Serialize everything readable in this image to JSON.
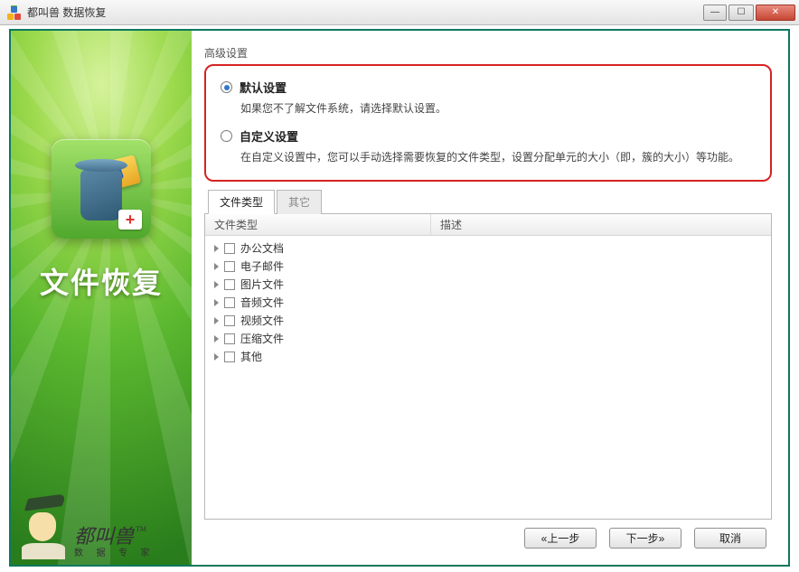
{
  "window": {
    "title": "都叫兽 数据恢复"
  },
  "sidebar": {
    "title": "文件恢复",
    "brand_name": "都叫兽",
    "brand_tagline": "数 据 专 家",
    "tm": "TM"
  },
  "settings": {
    "group_label": "高级设置",
    "default": {
      "label": "默认设置",
      "desc": "如果您不了解文件系统，请选择默认设置。"
    },
    "custom": {
      "label": "自定义设置",
      "desc": "在自定义设置中，您可以手动选择需要恢复的文件类型，设置分配单元的大小（即，簇的大小）等功能。"
    }
  },
  "tabs": {
    "file_type": "文件类型",
    "other": "其它"
  },
  "table": {
    "col_type": "文件类型",
    "col_desc": "描述",
    "rows": [
      {
        "label": "办公文档"
      },
      {
        "label": "电子邮件"
      },
      {
        "label": "图片文件"
      },
      {
        "label": "音频文件"
      },
      {
        "label": "视频文件"
      },
      {
        "label": "压缩文件"
      },
      {
        "label": "其他"
      }
    ]
  },
  "footer": {
    "prev": "«上一步",
    "next": "下一步»",
    "cancel": "取消"
  }
}
